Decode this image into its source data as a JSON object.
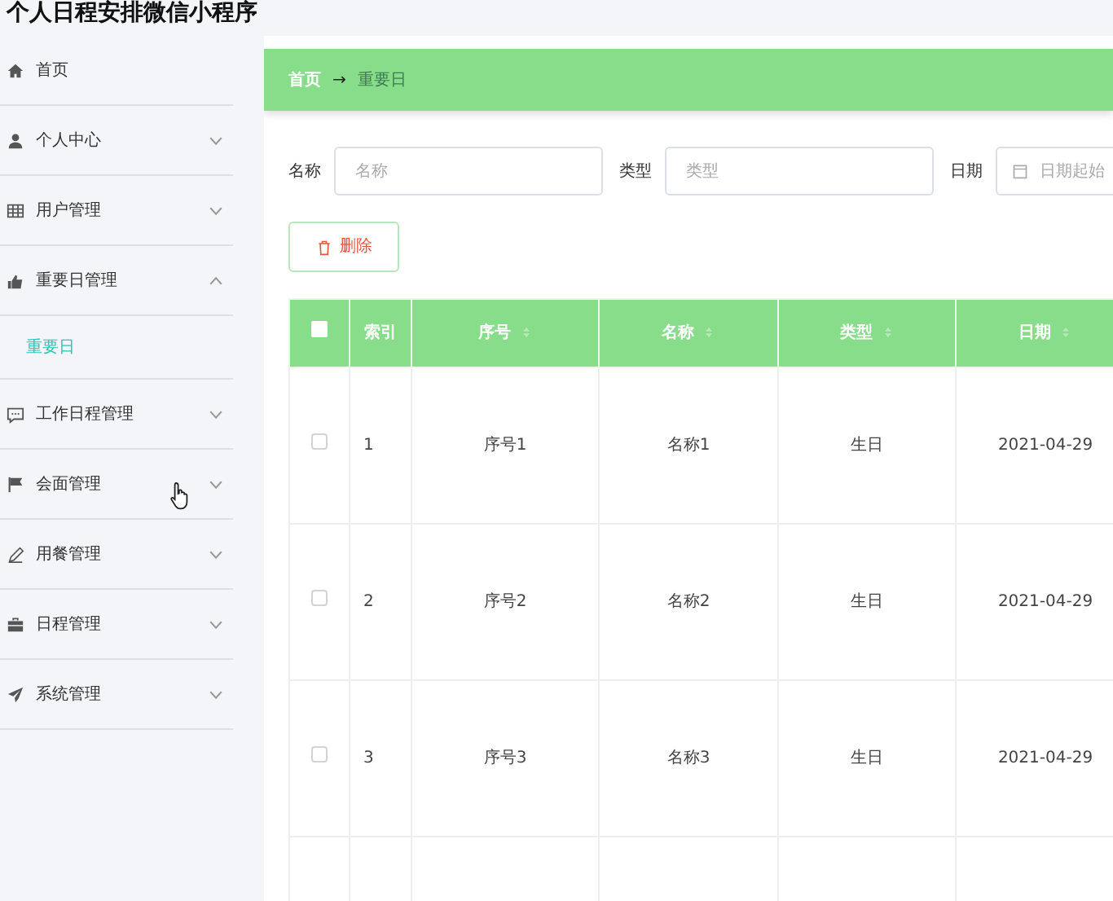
{
  "app_title": "个人日程安排微信小程序",
  "sidebar": {
    "items": [
      {
        "label": "首页",
        "kind": "link"
      },
      {
        "label": "个人中心",
        "kind": "submenu",
        "expanded": false
      },
      {
        "label": "用户管理",
        "kind": "submenu",
        "expanded": false
      },
      {
        "label": "重要日管理",
        "kind": "submenu",
        "expanded": true,
        "children": [
          {
            "label": "重要日",
            "selected": true
          }
        ]
      },
      {
        "label": "工作日程管理",
        "kind": "submenu",
        "expanded": false
      },
      {
        "label": "会面管理",
        "kind": "submenu",
        "expanded": false
      },
      {
        "label": "用餐管理",
        "kind": "submenu",
        "expanded": false
      },
      {
        "label": "日程管理",
        "kind": "submenu",
        "expanded": false
      },
      {
        "label": "系统管理",
        "kind": "submenu",
        "expanded": false
      }
    ]
  },
  "breadcrumb": {
    "home": "首页",
    "separator": "→",
    "current": "重要日"
  },
  "search": [
    {
      "label": "名称",
      "placeholder": "名称",
      "kind": "text"
    },
    {
      "label": "类型",
      "placeholder": "类型",
      "kind": "text"
    },
    {
      "label": "日期",
      "placeholder": "日期起始",
      "kind": "date"
    }
  ],
  "delete_button": {
    "label": "删除"
  },
  "table": {
    "select_all_checked": false,
    "columns": [
      {
        "label": "索引",
        "sortable": false
      },
      {
        "label": "序号",
        "sortable": true
      },
      {
        "label": "名称",
        "sortable": true
      },
      {
        "label": "类型",
        "sortable": true
      },
      {
        "label": "日期",
        "sortable": true
      }
    ],
    "rows": [
      {
        "checked": false,
        "cells": [
          "1",
          "序号1",
          "名称1",
          "生日",
          "2021-04-29"
        ]
      },
      {
        "checked": false,
        "cells": [
          "2",
          "序号2",
          "名称2",
          "生日",
          "2021-04-29"
        ]
      },
      {
        "checked": false,
        "cells": [
          "3",
          "序号3",
          "名称3",
          "生日",
          "2021-04-29"
        ]
      }
    ]
  }
}
